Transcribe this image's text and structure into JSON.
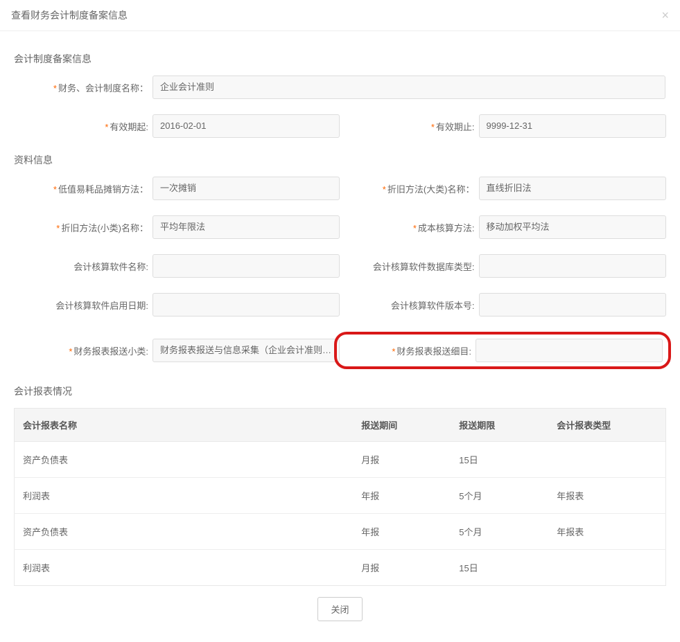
{
  "header": {
    "title": "查看财务会计制度备案信息"
  },
  "section1": {
    "title": "会计制度备案信息",
    "fields": {
      "system_name": {
        "label": "财务、会计制度名称：",
        "value": "企业会计准则",
        "required": true
      },
      "valid_from": {
        "label": "有效期起:",
        "value": "2016-02-01",
        "required": true
      },
      "valid_to": {
        "label": "有效期止:",
        "value": "9999-12-31",
        "required": true
      }
    }
  },
  "section2": {
    "title": "资料信息",
    "fields": {
      "low_value_method": {
        "label": "低值易耗品摊销方法：",
        "value": "一次摊销",
        "required": true
      },
      "depr_major": {
        "label": "折旧方法(大类)名称：",
        "value": "直线折旧法",
        "required": true
      },
      "depr_minor": {
        "label": "折旧方法(小类)名称：",
        "value": "平均年限法",
        "required": true
      },
      "cost_method": {
        "label": "成本核算方法:",
        "value": "移动加权平均法",
        "required": true
      },
      "software_name": {
        "label": "会计核算软件名称:",
        "value": "",
        "required": false
      },
      "db_type": {
        "label": "会计核算软件数据库类型:",
        "value": "",
        "required": false
      },
      "software_enable_date": {
        "label": "会计核算软件启用日期:",
        "value": "",
        "required": false
      },
      "software_version": {
        "label": "会计核算软件版本号:",
        "value": "",
        "required": false
      },
      "report_sub": {
        "label": "财务报表报送小类:",
        "value": "财务报表报送与信息采集（企业会计准则一般企",
        "required": true
      },
      "report_detail": {
        "label": "财务报表报送细目:",
        "value": "",
        "required": true
      }
    }
  },
  "section3": {
    "title": "会计报表情况",
    "columns": {
      "name": "会计报表名称",
      "period": "报送期间",
      "deadline": "报送期限",
      "type": "会计报表类型"
    },
    "rows": [
      {
        "name": "资产负债表",
        "period": "月报",
        "deadline": "15日",
        "type": ""
      },
      {
        "name": "利润表",
        "period": "年报",
        "deadline": "5个月",
        "type": "年报表"
      },
      {
        "name": "资产负债表",
        "period": "年报",
        "deadline": "5个月",
        "type": "年报表"
      },
      {
        "name": "利润表",
        "period": "月报",
        "deadline": "15日",
        "type": ""
      }
    ]
  },
  "footer": {
    "close_label": "关闭"
  }
}
